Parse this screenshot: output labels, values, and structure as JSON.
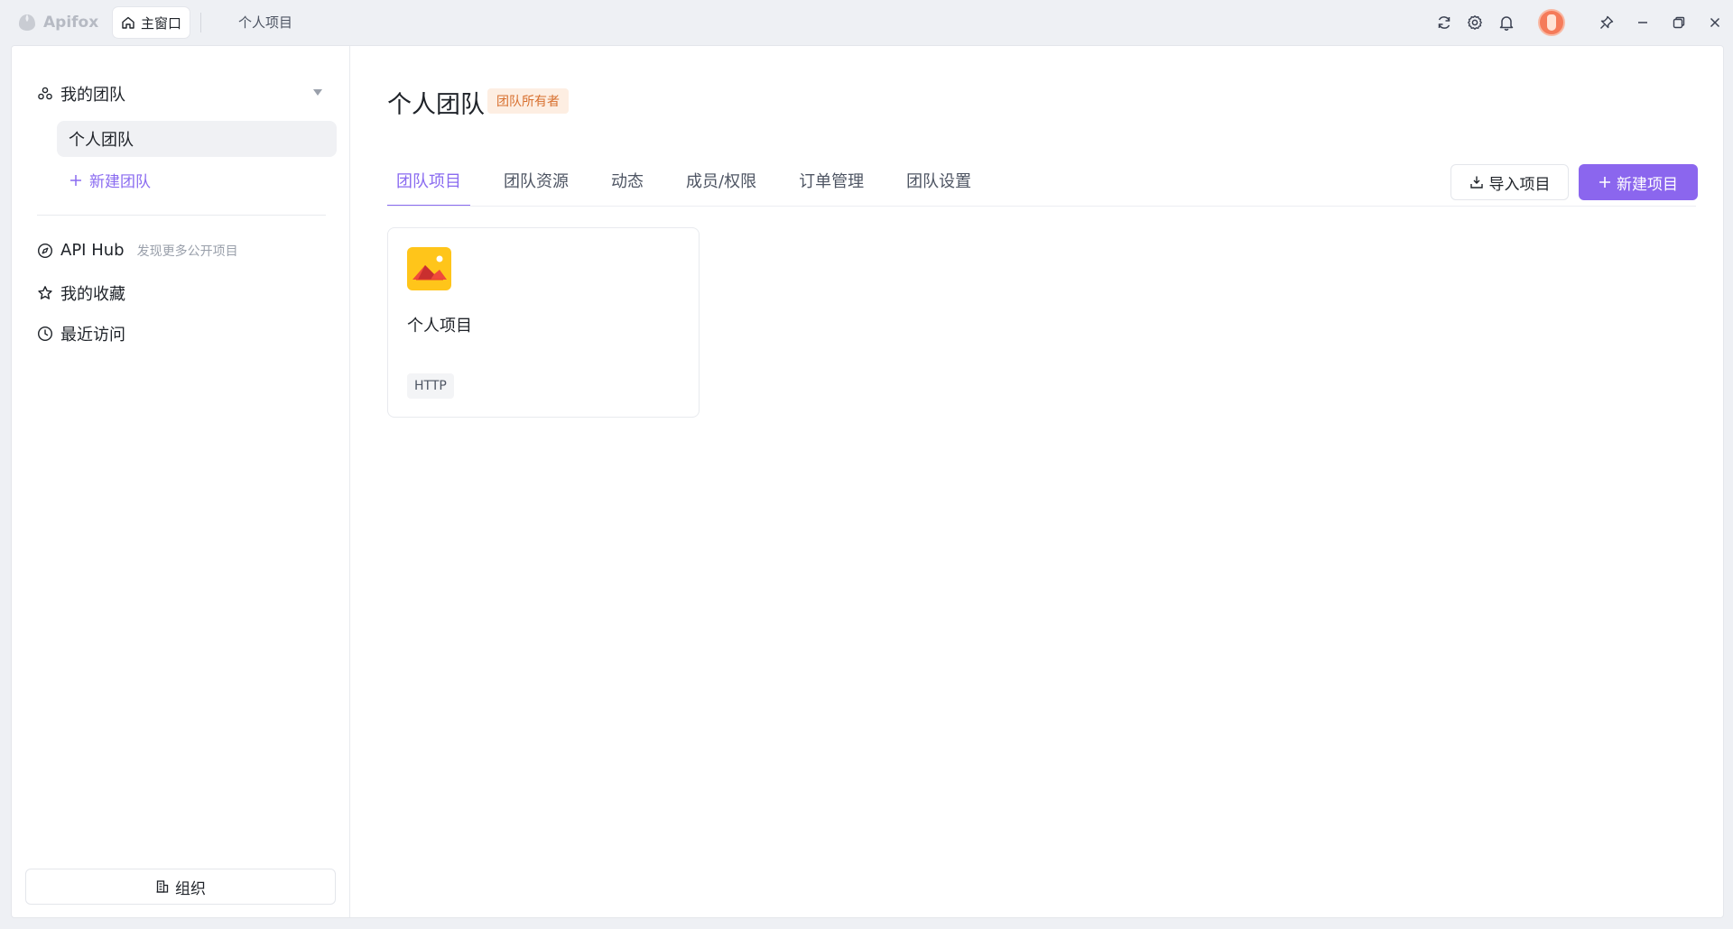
{
  "app": {
    "name": "Apifox",
    "home_tab": "主窗口",
    "project_tab": "个人项目"
  },
  "sidebar": {
    "section_title": "我的团队",
    "teams": [
      {
        "label": "个人团队"
      }
    ],
    "new_team": "新建团队",
    "nav": [
      {
        "label": "API Hub",
        "hint": "发现更多公开项目"
      },
      {
        "label": "我的收藏"
      },
      {
        "label": "最近访问"
      }
    ],
    "org_button": "组织"
  },
  "main": {
    "title": "个人团队",
    "badge": "团队所有者",
    "tabs": [
      {
        "label": "团队项目",
        "active": true
      },
      {
        "label": "团队资源"
      },
      {
        "label": "动态"
      },
      {
        "label": "成员/权限"
      },
      {
        "label": "订单管理"
      },
      {
        "label": "团队设置"
      }
    ],
    "import_button": "导入项目",
    "new_button": "新建项目",
    "projects": [
      {
        "name": "个人项目",
        "tag": "HTTP"
      }
    ]
  },
  "colors": {
    "accent": "#8b66ee",
    "badge_bg": "#fdeee2",
    "badge_text": "#d8702f",
    "project_icon": "#ffc51a"
  }
}
